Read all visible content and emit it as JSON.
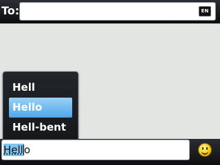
{
  "header": {
    "to_label": "To:",
    "to_value": "",
    "language_badge": "EN"
  },
  "message_area": {
    "body": ""
  },
  "suggestions": {
    "items": [
      {
        "label": "Hell",
        "selected": false
      },
      {
        "label": "Hello",
        "selected": true
      },
      {
        "label": "Hell-bent",
        "selected": false
      }
    ]
  },
  "compose": {
    "highlighted_text": "Hell",
    "trailing_text": "o"
  },
  "icons": {
    "emoticon": "smiley-icon"
  },
  "colors": {
    "selection": "#4fa7e8",
    "highlight": "#7fc3f2",
    "bar_background": "#1a1d21"
  }
}
